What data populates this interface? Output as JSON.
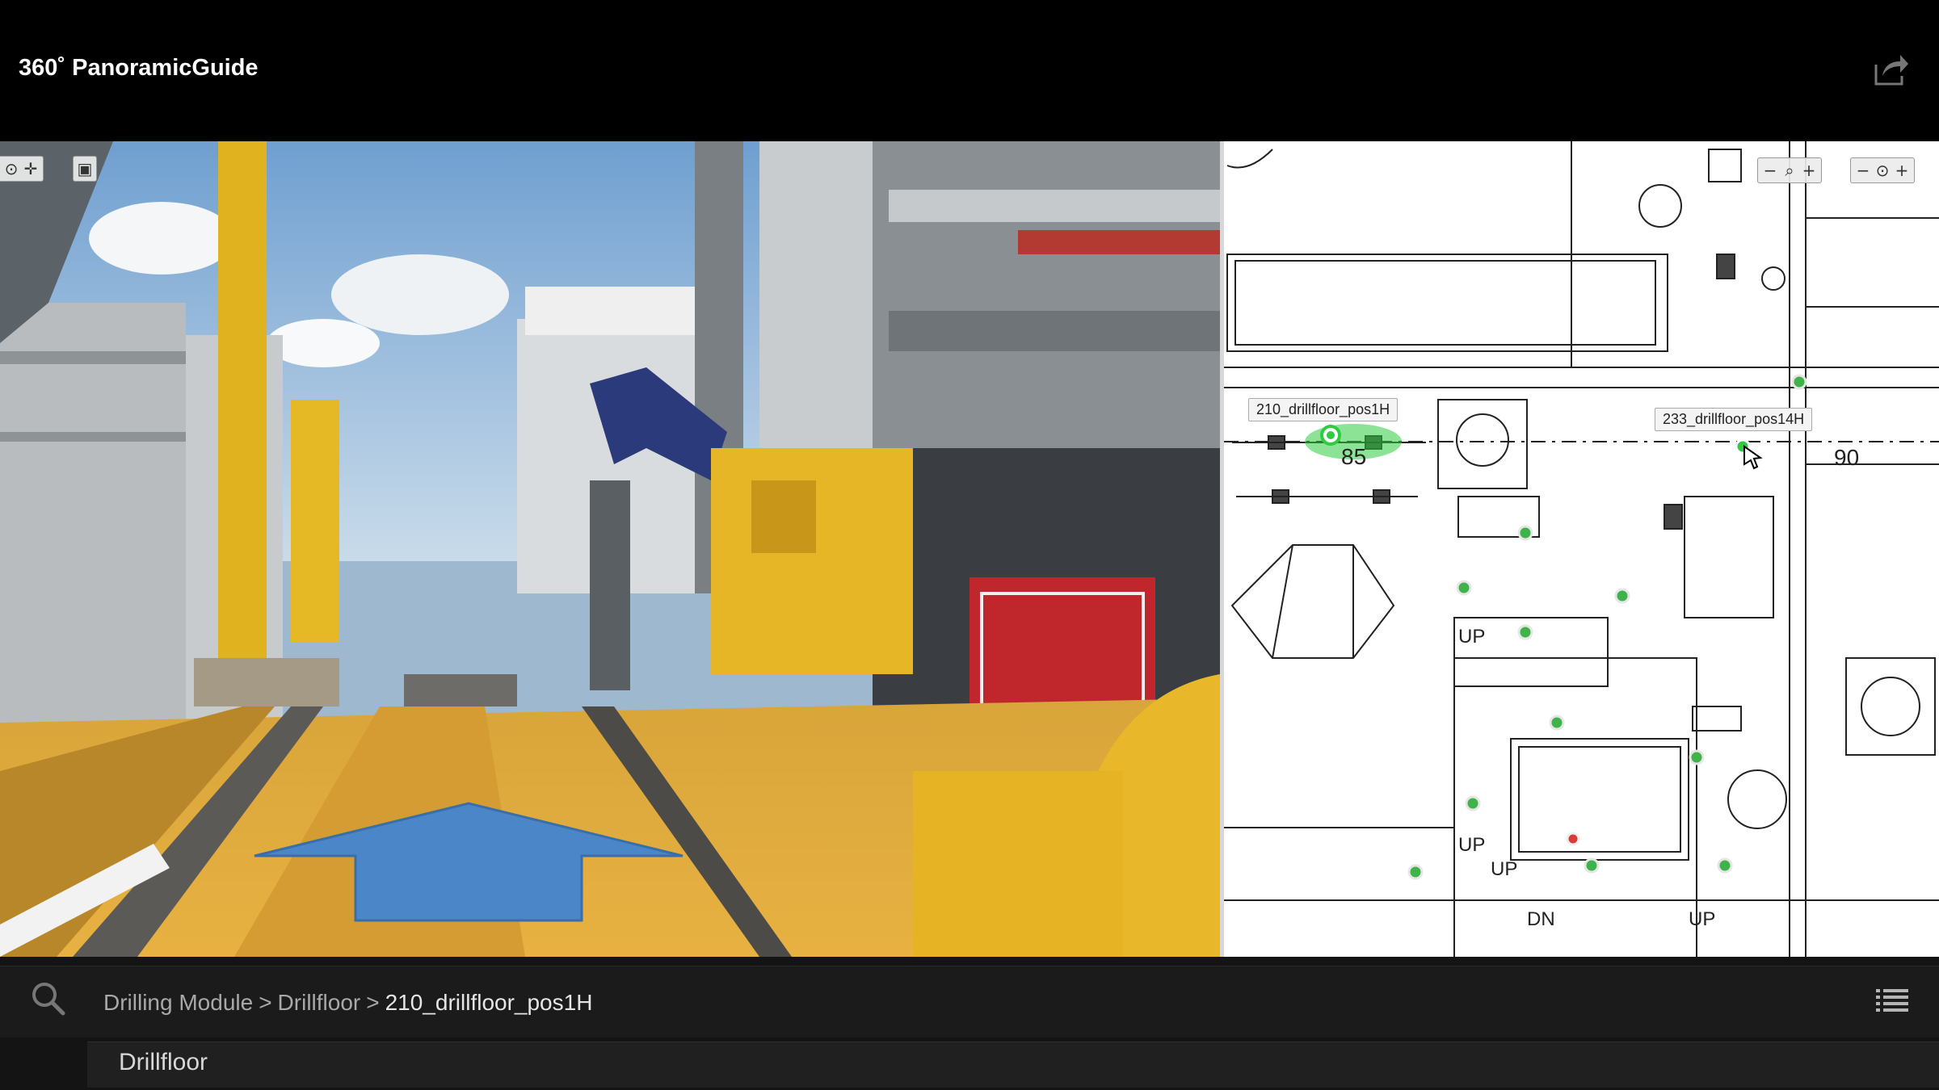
{
  "app": {
    "title": "360˚ PanoramicGuide"
  },
  "panorama": {
    "nav_arrow_color": "#4a86c8",
    "controls": [
      "locate-icon",
      "pan-icon",
      "fullscreen-icon"
    ]
  },
  "map": {
    "controls_left": [
      "zoom-out-icon",
      "zoom-icon",
      "zoom-in-icon"
    ],
    "controls_right": [
      "zoom-out-icon",
      "zoom-icon",
      "zoom-in-icon"
    ],
    "tooltip_current": "210_drillfloor_pos1H",
    "tooltip_hover": "233_drillfloor_pos14H",
    "label_85": "85",
    "label_90": "90",
    "label_up": "UP",
    "label_dn": "DN",
    "marker_color": "#3fb34a",
    "active_marker_color": "#2ecc40"
  },
  "breadcrumb": {
    "level1": "Drilling Module",
    "level2": "Drillfloor",
    "current": "210_drillfloor_pos1H",
    "separator": ">"
  },
  "section": {
    "title": "Drillfloor"
  }
}
